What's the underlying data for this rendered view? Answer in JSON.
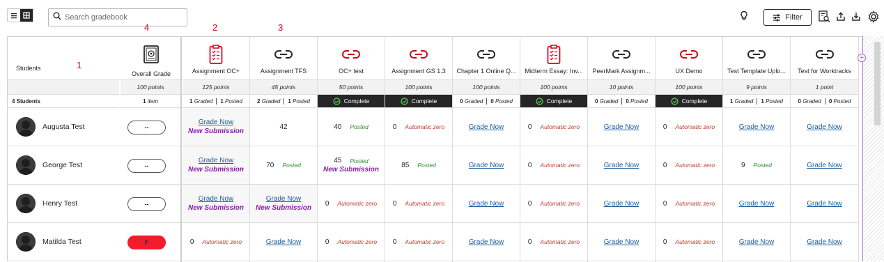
{
  "toolbar": {
    "search_placeholder": "Search gradebook",
    "filter_label": "Filter",
    "icons": [
      "list-view-icon",
      "grid-view-icon",
      "search-icon",
      "lightbulb-icon",
      "filter-sliders-icon",
      "grade-report-icon",
      "upload-icon",
      "download-icon",
      "gear-icon"
    ]
  },
  "annotations": [
    "1",
    "2",
    "3",
    "4"
  ],
  "students_header": "Students",
  "students_count": "4 Students",
  "overall": {
    "title": "Overall Grade",
    "points": "100 points",
    "summary": "1 item"
  },
  "columns": [
    {
      "title": "Assignment OC+",
      "icon": "assignment-icon",
      "points": "125 points",
      "graded": "1 Graded",
      "posted": "1 Posted"
    },
    {
      "title": "Assignment TFS",
      "icon": "link-icon",
      "points": "45 points",
      "graded": "2 Graded",
      "posted": "1 Posted"
    },
    {
      "title": "OC+ test",
      "icon": "link-icon-red",
      "points": "50 points",
      "complete": "Complete"
    },
    {
      "title": "Assignment GS 1.3",
      "icon": "link-icon-red",
      "points": "100 points",
      "complete": "Complete"
    },
    {
      "title": "Chapter 1 Online Q...",
      "icon": "link-icon",
      "points": "100 points",
      "graded": "0 Graded",
      "posted": "0 Posted"
    },
    {
      "title": "Midterm Essay: Inv...",
      "icon": "assignment-icon",
      "points": "100 points",
      "complete": "Complete"
    },
    {
      "title": "PeerMark Assignm...",
      "icon": "link-icon",
      "points": "10 points",
      "graded": "0 Graded",
      "posted": "0 Posted"
    },
    {
      "title": "UX Demo",
      "icon": "link-icon-red",
      "points": "100 points",
      "complete": "Complete"
    },
    {
      "title": "Test Template Uplo...",
      "icon": "link-icon",
      "points": "9 points",
      "graded": "1 Graded",
      "posted": "1 Posted"
    },
    {
      "title": "Test for Worktracks",
      "icon": "link-icon",
      "points": "1 point",
      "graded": "0 Graded",
      "posted": "0 Posted"
    }
  ],
  "students": [
    {
      "name": "Augusta Test",
      "overall": "--",
      "cells": [
        {
          "link": "Grade Now",
          "sub": "New Submission"
        },
        {
          "value": "42"
        },
        {
          "value": "40",
          "status": "Posted"
        },
        {
          "value": "0",
          "status": "Automatic zero"
        },
        {
          "link": "Grade Now"
        },
        {
          "value": "0",
          "status": "Automatic zero"
        },
        {
          "link": "Grade Now"
        },
        {
          "value": "0",
          "status": "Automatic zero"
        },
        {
          "link": "Grade Now"
        },
        {
          "link": "Grade Now"
        }
      ]
    },
    {
      "name": "George Test",
      "overall": "--",
      "cells": [
        {
          "link": "Grade Now",
          "sub": "New Submission"
        },
        {
          "value": "70",
          "status": "Posted"
        },
        {
          "value": "45",
          "status": "Posted",
          "sub": "New Submission"
        },
        {
          "value": "85",
          "status": "Posted"
        },
        {
          "link": "Grade Now"
        },
        {
          "value": "0",
          "status": "Automatic zero"
        },
        {
          "link": "Grade Now"
        },
        {
          "value": "0",
          "status": "Automatic zero"
        },
        {
          "value": "9",
          "status": "Posted"
        },
        {
          "link": "Grade Now"
        }
      ]
    },
    {
      "name": "Henry Test",
      "overall": "--",
      "cells": [
        {
          "link": "Grade Now",
          "sub": "New Submission"
        },
        {
          "link": "Grade Now",
          "sub": "New Submission"
        },
        {
          "value": "0",
          "status": "Automatic zero"
        },
        {
          "value": "0",
          "status": "Automatic zero"
        },
        {
          "link": "Grade Now"
        },
        {
          "value": "0",
          "status": "Automatic zero"
        },
        {
          "link": "Grade Now"
        },
        {
          "value": "0",
          "status": "Automatic zero"
        },
        {
          "link": "Grade Now"
        },
        {
          "link": "Grade Now"
        }
      ]
    },
    {
      "name": "Matilda Test",
      "overall": "F",
      "overall_fail": true,
      "cells": [
        {
          "value": "0",
          "status": "Automatic zero"
        },
        {
          "link": "Grade Now"
        },
        {
          "value": "0",
          "status": "Automatic zero"
        },
        {
          "value": "0",
          "status": "Automatic zero"
        },
        {
          "link": "Grade Now"
        },
        {
          "value": "0",
          "status": "Automatic zero"
        },
        {
          "link": "Grade Now"
        },
        {
          "value": "0",
          "status": "Automatic zero"
        },
        {
          "link": "Grade Now"
        },
        {
          "link": "Grade Now"
        }
      ]
    }
  ],
  "colors": {
    "accent_red": "#d0021b",
    "link_blue": "#1a5d9c",
    "new_submission_purple": "#8b1fa8",
    "posted_green": "#2c8a2c",
    "fail_red": "#f31c2c"
  }
}
